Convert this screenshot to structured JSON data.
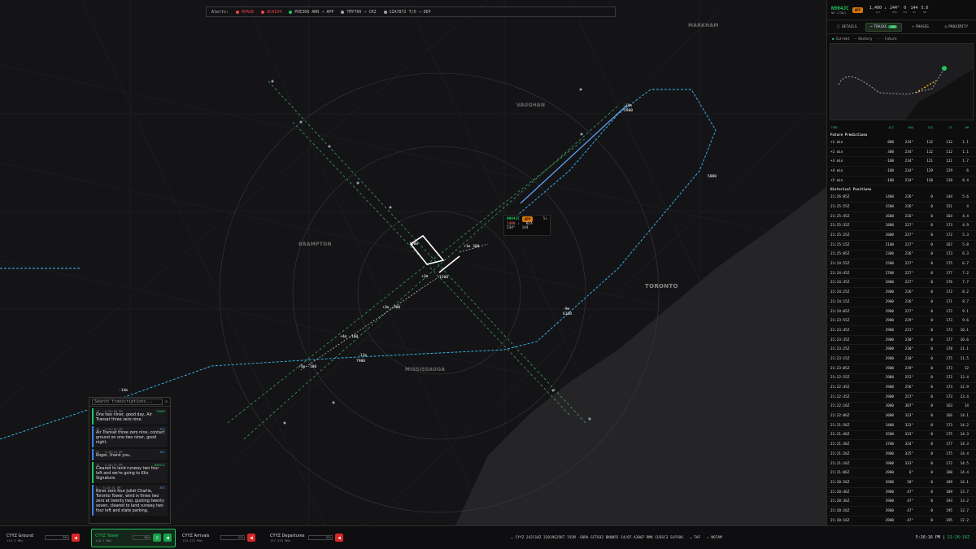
{
  "alerts": {
    "label": "Alerts:",
    "items": [
      {
        "text": "RPA26",
        "color": "#ef4444"
      },
      {
        "text": "ACA194",
        "color": "#ef4444"
      },
      {
        "text": "POE368 ARR → APP",
        "color": "#22c55e"
      },
      {
        "text": "TMY766 → CRZ",
        "color": "#9ca3af"
      },
      {
        "text": "SIA7872 T/O → DEP",
        "color": "#9ca3af"
      }
    ]
  },
  "map": {
    "cities": [
      "MARKHAM",
      "VAUGHAN",
      "BRAMPTON",
      "TORONTO",
      "MISSISSAUGA"
    ],
    "selected": {
      "callsign": "N904JC",
      "badge": "APP",
      "time": "5s",
      "alt": "1400 ↓",
      "gs": "N/A",
      "hdg": "234°",
      "spd": "144"
    },
    "track_labels": [
      "+1m 300",
      "+3m -100",
      "+4m -100",
      "+5m -100",
      "+2m",
      "-11m",
      "7900",
      "-10m",
      "2900",
      "-14m",
      "-9m",
      "6100",
      "5000",
      "1600",
      "1500"
    ]
  },
  "transcripts": {
    "placeholder": "Search transcriptions...",
    "messages": [
      {
        "meta": "15 · 5:26:00 PM",
        "tag": "TOWER",
        "text": "One two niner, good day, Air Transat three zero nine.",
        "tower": true
      },
      {
        "meta": "15 · 5:26:02 PM",
        "tag": "ATC",
        "text": "Air Transat three zero nine, contact ground on one two niner, good night.",
        "tower": false
      },
      {
        "meta": "25 · 5:26:10 PM",
        "tag": "ATC",
        "text": "Roger, thank you.",
        "tower": false
      },
      {
        "meta": "15 · 5:26:27 PM",
        "tag": "N904JC",
        "text": "Cleared to land runway two four left and we're going to Kilo Signature.",
        "tower": true
      },
      {
        "meta": "5 · 5:26:41 PM",
        "tag": "ATC",
        "text": "Niner zero four Juliet Charlie, Toronto Tower, wind is three two zero at twenty two, gusting twenty seven, cleared to land runway two four left and state parking.",
        "tower": false
      }
    ]
  },
  "side": {
    "callsign": "N904JC",
    "type": "NB C25B/L",
    "badge": "APP",
    "stats": [
      {
        "v": "1,400 ↓",
        "l": "ALT"
      },
      {
        "v": "244°",
        "l": "HDG"
      },
      {
        "v": "0",
        "l": "TAS"
      },
      {
        "v": "144",
        "l": "GS"
      },
      {
        "v": "5.6",
        "l": "NM"
      }
    ],
    "tabs": [
      "DETAILS",
      "TRACKS",
      "PHASES",
      "PROXIMITY"
    ],
    "tracks_count": "100",
    "legend": [
      "Current",
      "History",
      "Future"
    ],
    "columns": [
      "TIME",
      "ALT",
      "HDG",
      "TAS",
      "GS",
      "NM"
    ],
    "future_title": "Future Predictions",
    "future": [
      [
        "+1 min",
        "800",
        "234°",
        "112",
        "112",
        "1.1"
      ],
      [
        "+2 min",
        "300",
        "234°",
        "112",
        "112",
        "1.1"
      ],
      [
        "+3 min",
        "-100",
        "234°",
        "121",
        "121",
        "1.7"
      ],
      [
        "+4 min",
        "-100",
        "234°",
        "129",
        "129",
        "6"
      ],
      [
        "+5 min",
        "-100",
        "234°",
        "138",
        "138",
        "8.4"
      ]
    ],
    "history_title": "Historical Positions",
    "history": [
      [
        "21:26:05Z",
        "1400",
        "226°",
        "0",
        "144",
        "5.6"
      ],
      [
        "21:25:55Z",
        "1500",
        "226°",
        "0",
        "151",
        "4"
      ],
      [
        "21:25:45Z",
        "1600",
        "226°",
        "0",
        "164",
        "4.4"
      ],
      [
        "21:25:35Z",
        "1800",
        "227°",
        "0",
        "173",
        "4.9"
      ],
      [
        "21:25:25Z",
        "2000",
        "227°",
        "0",
        "172",
        "5.3"
      ],
      [
        "21:25:15Z",
        "2100",
        "227°",
        "0",
        "167",
        "5.8"
      ],
      [
        "21:25:05Z",
        "2300",
        "226°",
        "0",
        "173",
        "6.3"
      ],
      [
        "21:24:55Z",
        "2500",
        "227°",
        "0",
        "175",
        "6.7"
      ],
      [
        "21:24:45Z",
        "2700",
        "227°",
        "0",
        "177",
        "7.2"
      ],
      [
        "21:24:35Z",
        "2800",
        "227°",
        "0",
        "176",
        "7.7"
      ],
      [
        "21:24:25Z",
        "2900",
        "226°",
        "0",
        "172",
        "8.2"
      ],
      [
        "21:24:15Z",
        "2900",
        "226°",
        "0",
        "171",
        "8.7"
      ],
      [
        "21:24:05Z",
        "2900",
        "227°",
        "0",
        "172",
        "9.1"
      ],
      [
        "21:23:55Z",
        "2900",
        "229°",
        "0",
        "173",
        "9.6"
      ],
      [
        "21:23:45Z",
        "2900",
        "231°",
        "0",
        "173",
        "10.1"
      ],
      [
        "21:23:35Z",
        "2900",
        "230°",
        "0",
        "177",
        "10.6"
      ],
      [
        "21:23:25Z",
        "2900",
        "230°",
        "0",
        "178",
        "11.1"
      ],
      [
        "21:23:15Z",
        "2900",
        "230°",
        "0",
        "175",
        "11.5"
      ],
      [
        "21:23:05Z",
        "2900",
        "239°",
        "0",
        "173",
        "12"
      ],
      [
        "21:22:55Z",
        "2900",
        "252°",
        "0",
        "172",
        "12.4"
      ],
      [
        "21:22:45Z",
        "2900",
        "256°",
        "0",
        "173",
        "12.9"
      ],
      [
        "21:22:35Z",
        "2900",
        "257°",
        "0",
        "173",
        "13.4"
      ],
      [
        "21:22:16Z",
        "3000",
        "307°",
        "0",
        "163",
        "14"
      ],
      [
        "21:22:06Z",
        "3000",
        "323°",
        "0",
        "166",
        "14.1"
      ],
      [
        "21:21:56Z",
        "3400",
        "323°",
        "0",
        "173",
        "14.2"
      ],
      [
        "21:21:46Z",
        "3500",
        "323°",
        "0",
        "175",
        "14.3"
      ],
      [
        "21:21:36Z",
        "3700",
        "324°",
        "0",
        "177",
        "14.3"
      ],
      [
        "21:21:26Z",
        "3900",
        "325°",
        "0",
        "175",
        "14.4"
      ],
      [
        "21:21:16Z",
        "3900",
        "333°",
        "0",
        "172",
        "14.5"
      ],
      [
        "21:21:06Z",
        "3900",
        "6°",
        "0",
        "180",
        "14.4"
      ],
      [
        "21:20:56Z",
        "3900",
        "50°",
        "0",
        "189",
        "14.1"
      ],
      [
        "21:20:46Z",
        "3900",
        "47°",
        "0",
        "189",
        "13.7"
      ],
      [
        "21:20:36Z",
        "3900",
        "47°",
        "0",
        "193",
        "13.2"
      ],
      [
        "21:20:26Z",
        "3900",
        "47°",
        "0",
        "195",
        "12.7"
      ],
      [
        "21:20:16Z",
        "3900",
        "47°",
        "0",
        "195",
        "12.2"
      ]
    ]
  },
  "bottom": {
    "freqs": [
      {
        "name": "CYYZ Ground",
        "hz": "119.3 MHz",
        "vol": "34%",
        "active": false
      },
      {
        "name": "CYYZ Tower",
        "hz": "118.7 MHz",
        "vol": "34%",
        "active": true
      },
      {
        "name": "CYYZ Arrivals",
        "hz": "124.475 MHz",
        "vol": "51%",
        "active": false
      },
      {
        "name": "CYYZ Departures",
        "hz": "127.575 MHz",
        "vol": "51%",
        "active": false
      }
    ],
    "metar": "CYYZ 242118Z 31019G25KT 15SM -SHRA SCT032 BKN055 14/07 A3007 RMK CU3SC3 SLP186",
    "taf": "TAF",
    "notam": "NOTAM",
    "local_time": "5:26:16 PM",
    "zulu_time": "21:26:16Z"
  }
}
